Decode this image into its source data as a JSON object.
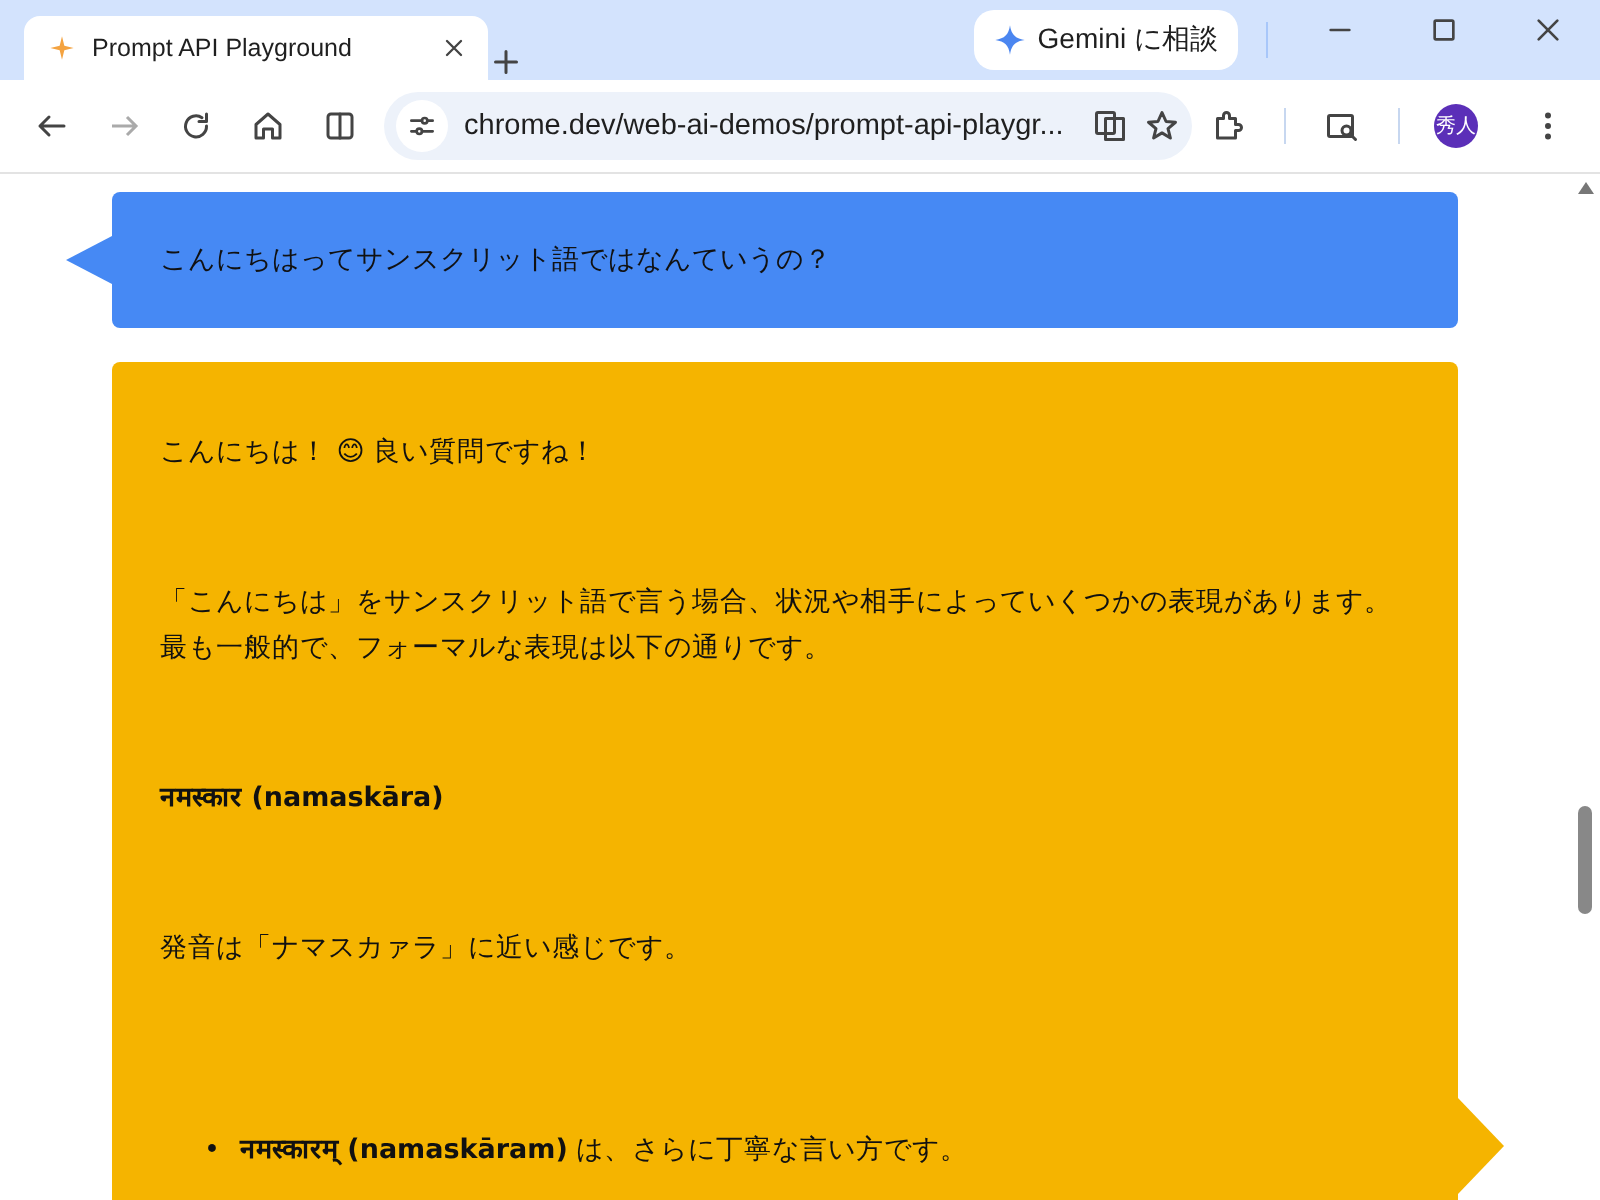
{
  "browser": {
    "tabs": [
      {
        "title": "Prompt API Playground",
        "selected": true
      }
    ],
    "gemini_button": "Gemini に相談",
    "address": "chrome.dev/web-ai-demos/prompt-api-playgr...",
    "profile": "秀人"
  },
  "messages": [
    {
      "kind": "user",
      "blocks": [
        {
          "kind": "p",
          "text": "こんにちはってサンスクリット語ではなんていうの？"
        }
      ]
    },
    {
      "kind": "model",
      "blocks": [
        {
          "kind": "p",
          "text": "こんにちは！ 😊 良い質問ですね！"
        },
        {
          "kind": "p",
          "text": "「こんにちは」をサンスクリット語で言う場合、状況や相手によっていくつかの表現があります。最も一般的で、フォーマルな表現は以下の通りです。"
        },
        {
          "kind": "strong",
          "text": "नमस्कार (namaskāra)"
        },
        {
          "kind": "p",
          "text": "発音は「ナマスカァラ」に近い感じです。"
        },
        {
          "kind": "li",
          "marker": "•",
          "text": "**नमस्कारम् (namaskāram)** は、さらに丁寧な言い方です。"
        }
      ]
    }
  ]
}
